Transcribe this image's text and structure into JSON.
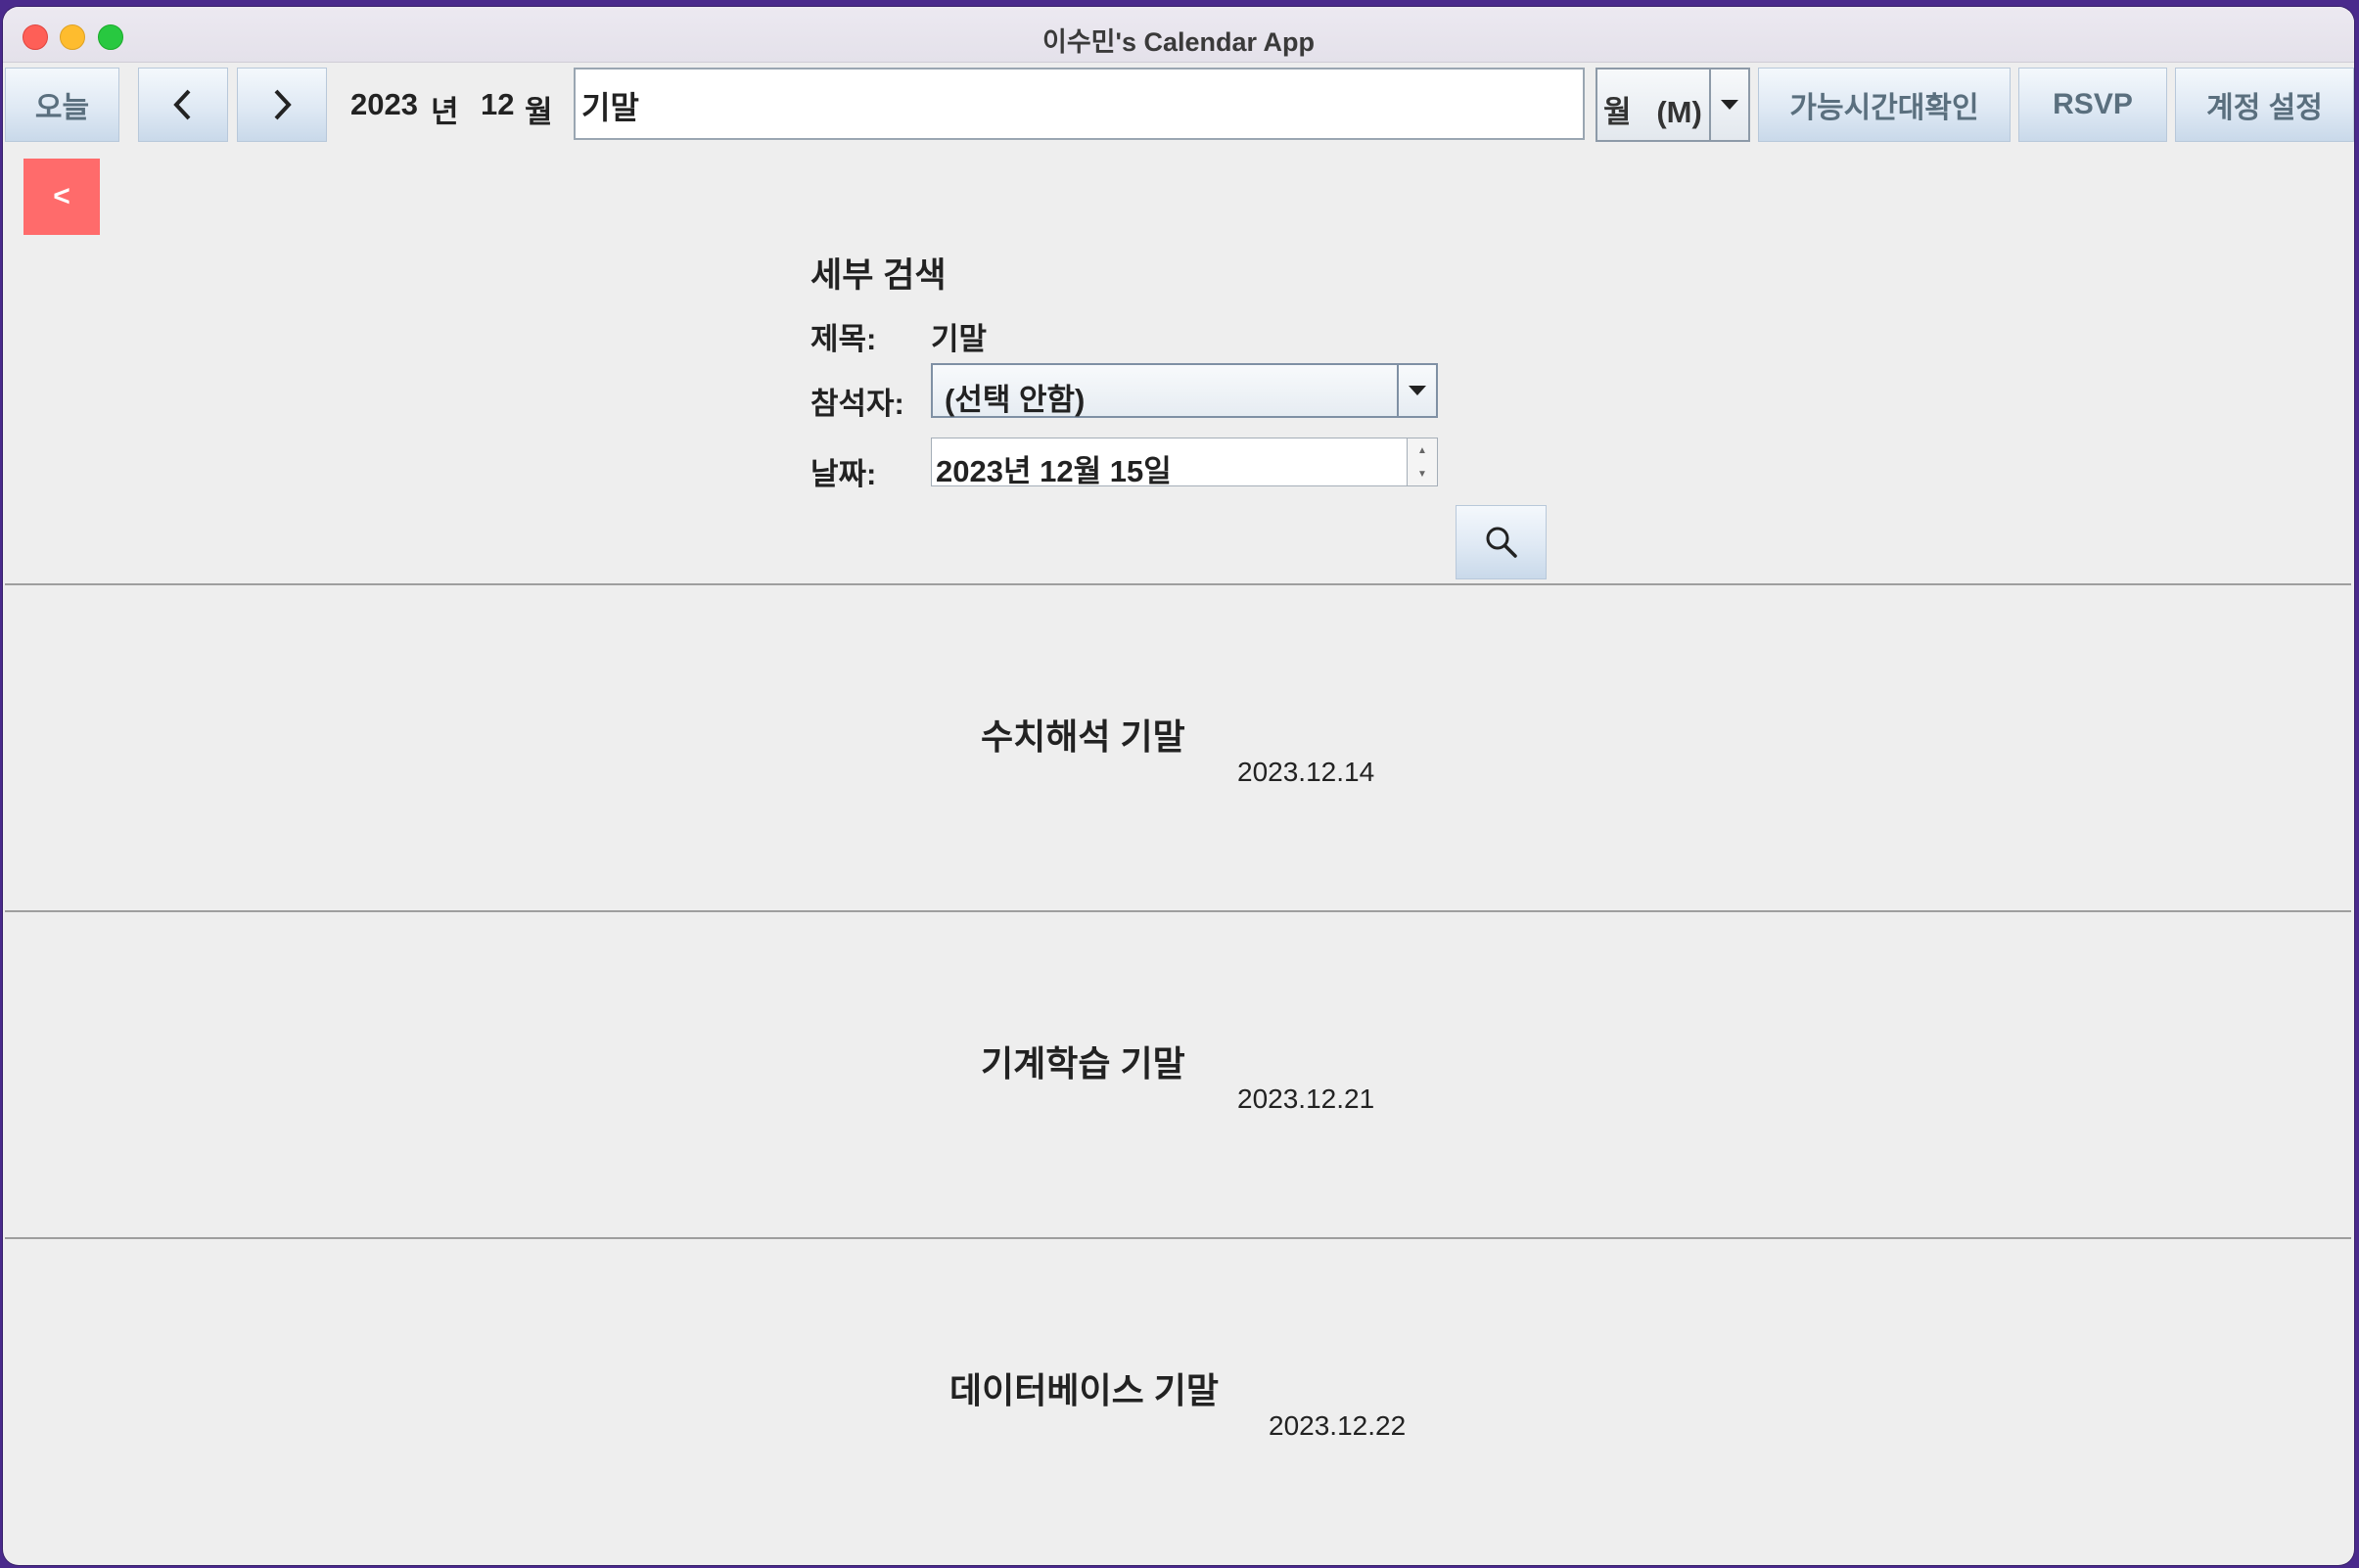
{
  "window": {
    "title": "이수민's Calendar App"
  },
  "toolbar": {
    "today_label": "오늘",
    "year": "2023",
    "year_unit": "년",
    "month": "12",
    "month_unit": "월",
    "search_value": "기말",
    "view_select": "월   (M)",
    "availability_label": "가능시간대확인",
    "rsvp_label": "RSVP",
    "account_label": "계정 설정"
  },
  "back_button_label": "<",
  "detail_search": {
    "title": "세부 검색",
    "title_label": "제목:",
    "title_value": "기말",
    "attendee_label": "참석자:",
    "attendee_value": "(선택 안함)",
    "date_label": "날짜:",
    "date_value": "2023년 12월 15일"
  },
  "results": [
    {
      "title": "수치해석 기말",
      "date": "2023.12.14"
    },
    {
      "title": "기계학습 기말",
      "date": "2023.12.21"
    },
    {
      "title": "데이터베이스 기말",
      "date": "2023.12.22"
    }
  ],
  "colors": {
    "back_button": "#ff6b6b",
    "button_text": "#5a6f7e",
    "window_bg": "#eeeeee"
  }
}
